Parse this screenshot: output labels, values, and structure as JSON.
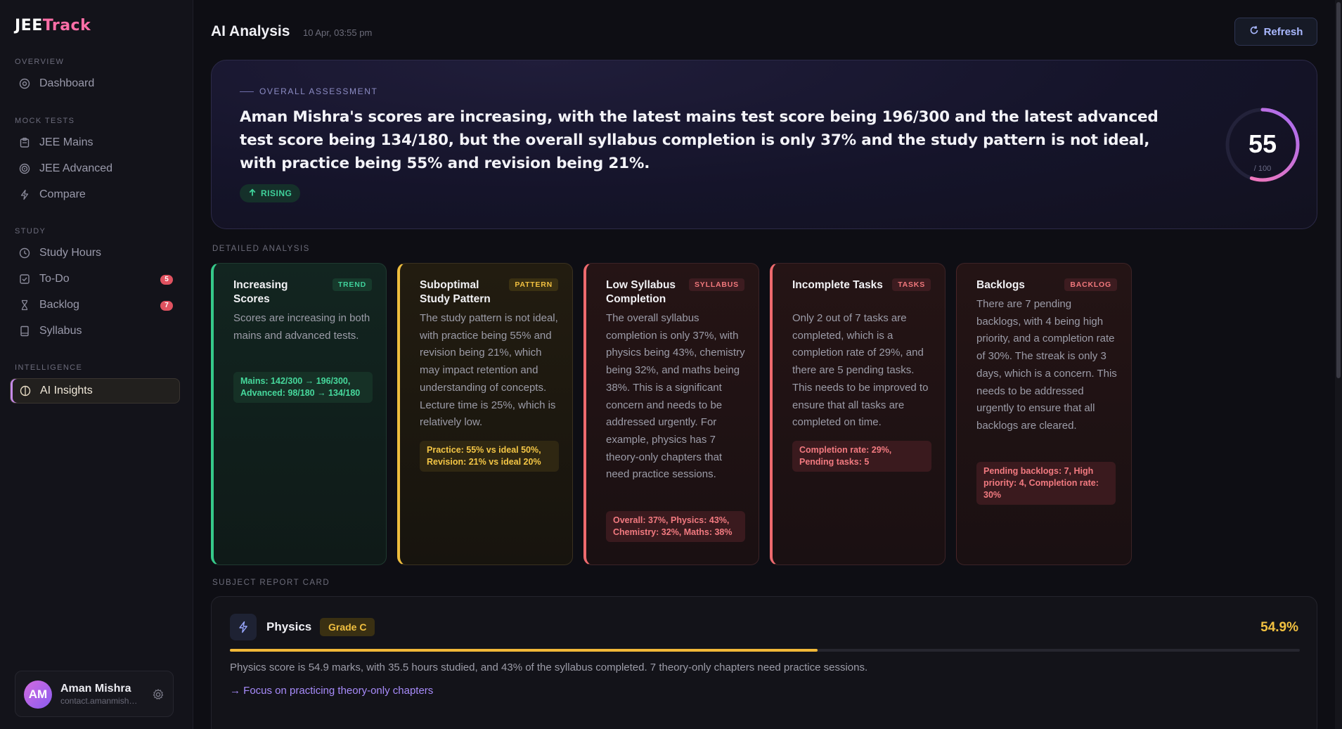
{
  "app": {
    "logo_a": "JEE",
    "logo_b": "Track"
  },
  "sidebar": {
    "sections": {
      "overview": "OVERVIEW",
      "mock_tests": "MOCK TESTS",
      "study": "STUDY",
      "intelligence": "INTELLIGENCE"
    },
    "items": [
      {
        "label": "Dashboard",
        "icon": "dashboard-icon"
      },
      {
        "label": "JEE Mains",
        "icon": "clipboard-icon"
      },
      {
        "label": "JEE Advanced",
        "icon": "target-icon"
      },
      {
        "label": "Compare",
        "icon": "bolt-icon"
      },
      {
        "label": "Study Hours",
        "icon": "clock-icon"
      },
      {
        "label": "To-Do",
        "icon": "checkbox-icon",
        "badge": "5"
      },
      {
        "label": "Backlog",
        "icon": "hourglass-icon",
        "badge": "7"
      },
      {
        "label": "Syllabus",
        "icon": "book-icon"
      },
      {
        "label": "AI Insights",
        "icon": "bulb-icon",
        "active": true
      }
    ],
    "user": {
      "initials": "AM",
      "name": "Aman Mishra",
      "email": "contact.amanmishr..."
    }
  },
  "header": {
    "title": "AI Analysis",
    "timestamp": "10 Apr, 03:55 pm",
    "refresh_label": "Refresh"
  },
  "assessment": {
    "label": "OVERALL ASSESSMENT",
    "text": "Aman Mishra's scores are increasing, with the latest mains test score being 196/300 and the latest advanced test score being 134/180, but the overall syllabus completion is only 37% and the study pattern is not ideal, with practice being 55% and revision being 21%.",
    "trend": "RISING",
    "score": "55",
    "score_max": "/ 100",
    "score_fraction": 0.55
  },
  "detailed": {
    "heading": "DETAILED ANALYSIS",
    "cards": [
      {
        "title": "Increasing Scores",
        "tag": "TREND",
        "body": "Scores are increasing in both mains and advanced tests.",
        "metric": "Mains: 142/300 → 196/300, Advanced: 98/180 → 134/180"
      },
      {
        "title": "Suboptimal Study Pattern",
        "tag": "PATTERN",
        "body": "The study pattern is not ideal, with practice being 55% and revision being 21%, which may impact retention and understanding of concepts. Lecture time is 25%, which is relatively low.",
        "metric": "Practice: 55% vs ideal 50%, Revision: 21% vs ideal 20%"
      },
      {
        "title": "Low Syllabus Completion",
        "tag": "SYLLABUS",
        "body": "The overall syllabus completion is only 37%, with physics being 43%, chemistry being 32%, and maths being 38%. This is a significant concern and needs to be addressed urgently. For example, physics has 7 theory-only chapters that need practice sessions.",
        "metric": "Overall: 37%, Physics: 43%, Chemistry: 32%, Maths: 38%"
      },
      {
        "title": "Incomplete Tasks",
        "tag": "TASKS",
        "body": "Only 2 out of 7 tasks are completed, which is a completion rate of 29%, and there are 5 pending tasks. This needs to be improved to ensure that all tasks are completed on time.",
        "metric": "Completion rate: 29%, Pending tasks: 5"
      },
      {
        "title": "Backlogs",
        "tag": "BACKLOG",
        "body": "There are 7 pending backlogs, with 4 being high priority, and a completion rate of 30%. The streak is only 3 days, which is a concern. This needs to be addressed urgently to ensure that all backlogs are cleared.",
        "metric": "Pending backlogs: 7, High priority: 4, Completion rate: 30%"
      }
    ]
  },
  "report": {
    "heading": "SUBJECT REPORT CARD",
    "subject": "Physics",
    "grade": "Grade C",
    "percent": "54.9%",
    "progress": 0.549,
    "description": "Physics score is 54.9 marks, with 35.5 hours studied, and 43% of the syllabus completed. 7 theory-only chapters need practice sessions.",
    "action": "→ Focus on practicing theory-only chapters"
  }
}
